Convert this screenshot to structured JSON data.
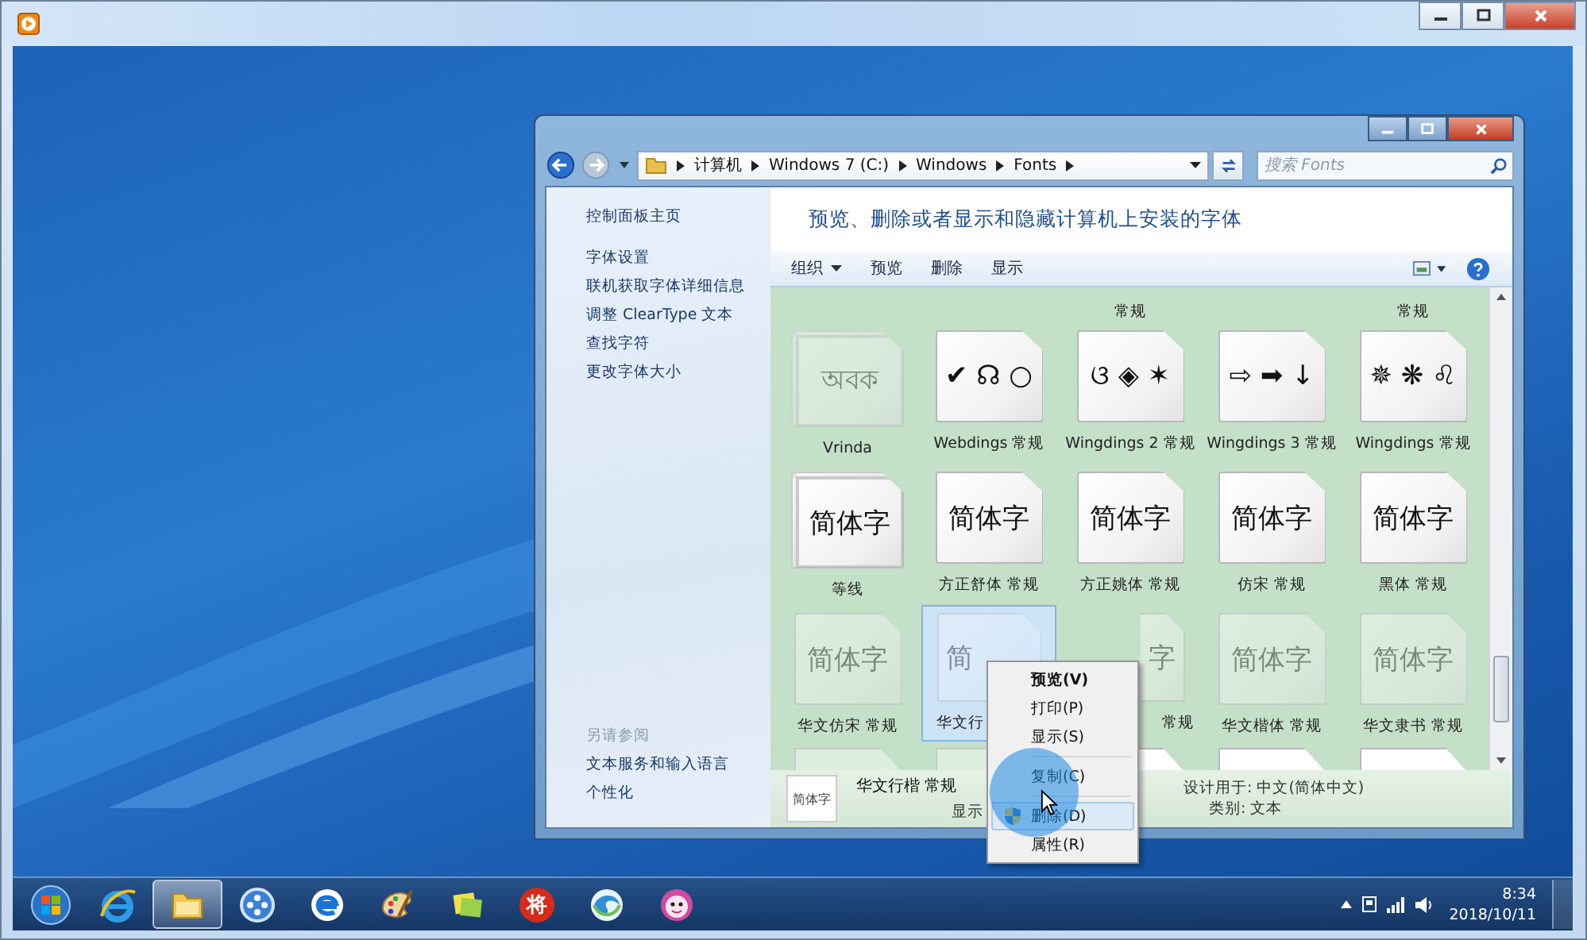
{
  "explorer": {
    "address": [
      "计算机",
      "Windows 7 (C:)",
      "Windows",
      "Fonts"
    ],
    "search": {
      "placeholder": "搜索 Fonts"
    },
    "nav": {
      "home": "控制面板主页",
      "links": [
        "字体设置",
        "联机获取字体详细信息",
        "调整 ClearType 文本",
        "查找字符",
        "更改字体大小"
      ],
      "see_also_title": "另请参阅",
      "see_also": [
        "文本服务和输入语言",
        "个性化"
      ]
    },
    "heading": "预览、删除或者显示和隐藏计算机上安装的字体",
    "toolbar": [
      {
        "label": "组织",
        "dropdown": true
      },
      {
        "label": "预览",
        "dropdown": false
      },
      {
        "label": "删除",
        "dropdown": false
      },
      {
        "label": "显示",
        "dropdown": false
      }
    ],
    "partial_row": [
      {
        "kind": "blank"
      },
      {
        "kind": "blank"
      },
      {
        "kind": "label",
        "label": "常规"
      },
      {
        "kind": "blank"
      },
      {
        "kind": "label",
        "label": "常规"
      }
    ],
    "fonts": [
      {
        "label": "Vrinda",
        "sample": "অবক",
        "hidden": true,
        "stacked": true,
        "selected": false
      },
      {
        "label": "Webdings 常规",
        "sample": "✔ ☊ ○",
        "hidden": false,
        "stacked": false,
        "selected": false
      },
      {
        "label": "Wingdings 2 常规",
        "sample": "ଓ ◈ ✶",
        "hidden": false,
        "stacked": false,
        "selected": false
      },
      {
        "label": "Wingdings 3 常规",
        "sample": "⇨ ➡ ↓",
        "hidden": false,
        "stacked": false,
        "selected": false
      },
      {
        "label": "Wingdings 常规",
        "sample": "✵ ❋ ♌",
        "hidden": false,
        "stacked": false,
        "selected": false
      },
      {
        "label": "等线",
        "sample": "简体字",
        "hidden": false,
        "stacked": true,
        "selected": false
      },
      {
        "label": "方正舒体 常规",
        "sample": "简体字",
        "hidden": false,
        "stacked": false,
        "selected": false
      },
      {
        "label": "方正姚体 常规",
        "sample": "简体字",
        "hidden": false,
        "stacked": false,
        "selected": false
      },
      {
        "label": "仿宋 常规",
        "sample": "简体字",
        "hidden": false,
        "stacked": false,
        "selected": false
      },
      {
        "label": "黑体 常规",
        "sample": "简体字",
        "hidden": false,
        "stacked": false,
        "selected": false
      },
      {
        "label": "华文仿宋 常规",
        "sample": "简体字",
        "hidden": true,
        "stacked": false,
        "selected": false
      },
      {
        "label": "华文行",
        "sample": "简",
        "hidden": true,
        "stacked": false,
        "selected": true,
        "kind": "cutend"
      },
      {
        "label": "常规",
        "sample": "字",
        "hidden": true,
        "stacked": false,
        "selected": false,
        "kind": "cutstart"
      },
      {
        "label": "华文楷体 常规",
        "sample": "简体字",
        "hidden": true,
        "stacked": false,
        "selected": false
      },
      {
        "label": "华文隶书 常规",
        "sample": "简体字",
        "hidden": true,
        "stacked": false,
        "selected": false
      }
    ],
    "details": {
      "name": "华文行楷 常规",
      "sample": "简体字",
      "show": "显示",
      "design": "设计用于: 中文(简体中文)",
      "category": "类别: 文本"
    }
  },
  "context_menu": [
    {
      "kind": "item",
      "label": "预览(V)",
      "default": true,
      "highlighted": false
    },
    {
      "kind": "item",
      "label": "打印(P)",
      "default": false,
      "highlighted": false
    },
    {
      "kind": "item",
      "label": "显示(S)",
      "default": false,
      "highlighted": false
    },
    {
      "kind": "separator"
    },
    {
      "kind": "item",
      "label": "复制(C)",
      "default": false,
      "highlighted": false
    },
    {
      "kind": "separator"
    },
    {
      "kind": "shield",
      "label": "删除(D)",
      "default": false,
      "highlighted": true
    },
    {
      "kind": "item",
      "label": "属性(R)",
      "default": false,
      "highlighted": false
    }
  ],
  "taskbar": {
    "apps": [
      {
        "kind": "start",
        "active": false
      },
      {
        "kind": "ie",
        "active": false
      },
      {
        "kind": "folder",
        "active": true
      },
      {
        "kind": "media",
        "active": false
      },
      {
        "kind": "e",
        "active": false
      },
      {
        "kind": "paint",
        "active": false
      },
      {
        "kind": "notes",
        "active": false
      },
      {
        "kind": "badge",
        "label": "将",
        "active": false
      },
      {
        "kind": "swirl",
        "active": false
      },
      {
        "kind": "face",
        "active": false
      }
    ],
    "clock": {
      "time": "8:34",
      "date": "2018/10/11"
    }
  }
}
